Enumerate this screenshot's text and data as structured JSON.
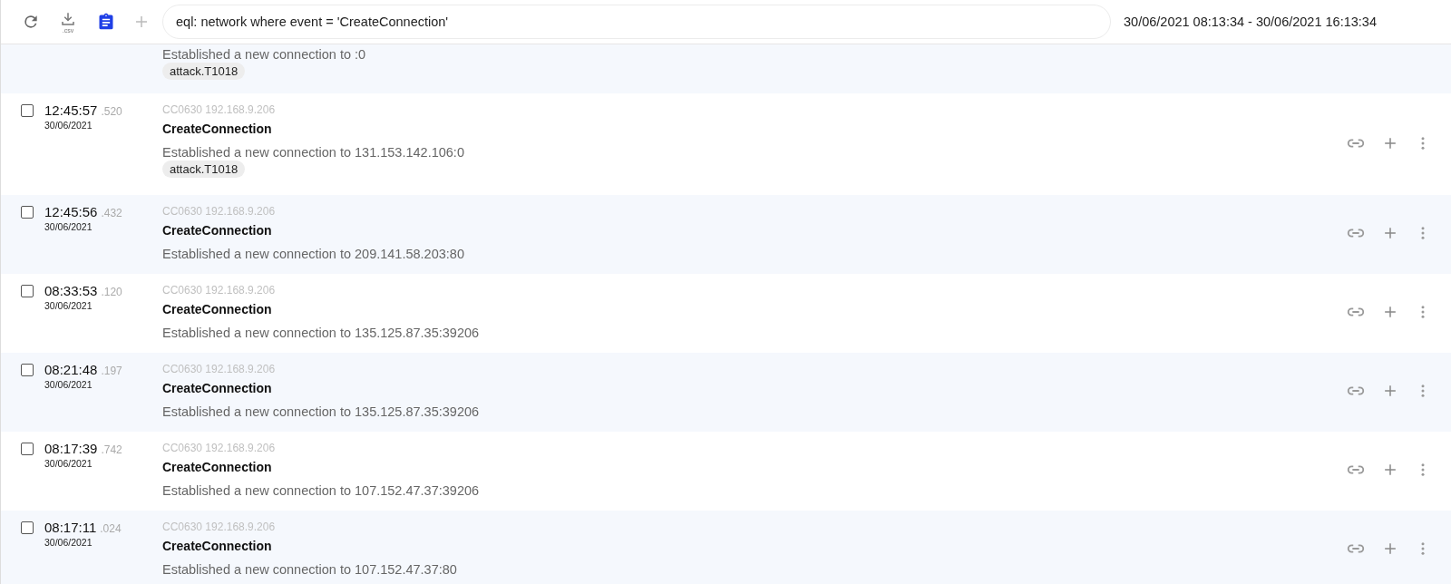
{
  "toolbar": {
    "query": "eql: network where event = 'CreateConnection'",
    "download_label": ".csv",
    "time_range": "30/06/2021 08:13:34 - 30/06/2021 16:13:34"
  },
  "events": [
    {
      "kind": "partial",
      "description": "Established a new connection to :0",
      "tags": [
        "attack.T1018"
      ]
    },
    {
      "kind": "full",
      "checked": false,
      "time": "12:45:57",
      "ms": ".520",
      "date": "30/06/2021",
      "host": "CC0630 192.168.9.206",
      "title": "CreateConnection",
      "description": "Established a new connection to 131.153.142.106:0",
      "tags": [
        "attack.T1018"
      ]
    },
    {
      "kind": "full",
      "checked": false,
      "time": "12:45:56",
      "ms": ".432",
      "date": "30/06/2021",
      "host": "CC0630 192.168.9.206",
      "title": "CreateConnection",
      "description": "Established a new connection to 209.141.58.203:80"
    },
    {
      "kind": "full",
      "checked": false,
      "time": "08:33:53",
      "ms": ".120",
      "date": "30/06/2021",
      "host": "CC0630 192.168.9.206",
      "title": "CreateConnection",
      "description": "Established a new connection to 135.125.87.35:39206"
    },
    {
      "kind": "full",
      "checked": false,
      "time": "08:21:48",
      "ms": ".197",
      "date": "30/06/2021",
      "host": "CC0630 192.168.9.206",
      "title": "CreateConnection",
      "description": "Established a new connection to 135.125.87.35:39206"
    },
    {
      "kind": "full",
      "checked": false,
      "time": "08:17:39",
      "ms": ".742",
      "date": "30/06/2021",
      "host": "CC0630 192.168.9.206",
      "title": "CreateConnection",
      "description": "Established a new connection to 107.152.47.37:39206"
    },
    {
      "kind": "full",
      "checked": false,
      "time": "08:17:11",
      "ms": ".024",
      "date": "30/06/2021",
      "host": "CC0630 192.168.9.206",
      "title": "CreateConnection",
      "description": "Established a new connection to 107.152.47.37:80"
    }
  ]
}
